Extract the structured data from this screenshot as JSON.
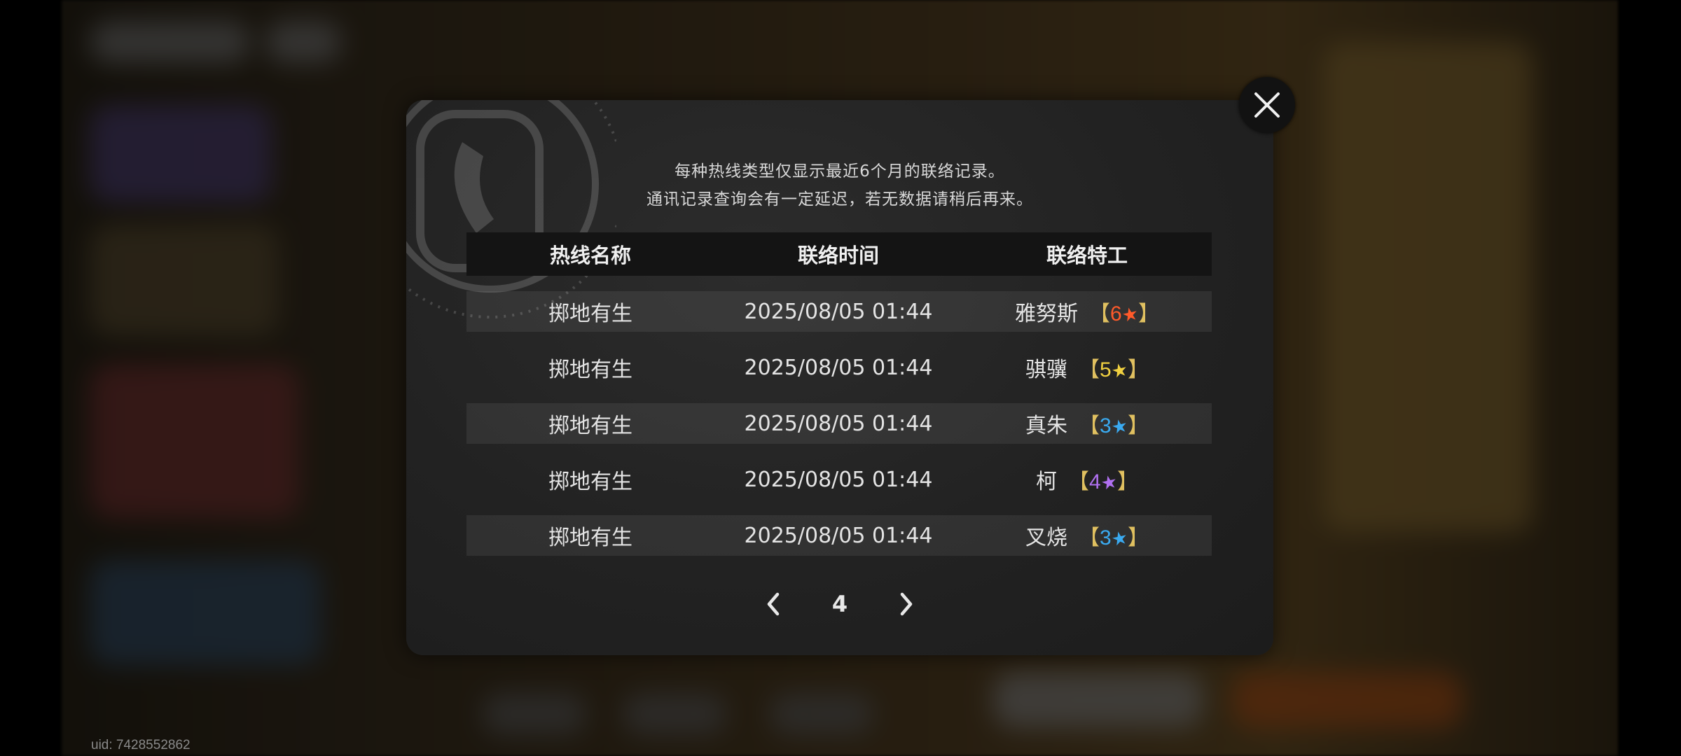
{
  "uid": "uid: 7428552862",
  "notice": {
    "line1": "每种热线类型仅显示最近6个月的联络记录。",
    "line2": "通讯记录查询会有一定延迟，若无数据请稍后再来。"
  },
  "table": {
    "headers": [
      "热线名称",
      "联络时间",
      "联络特工"
    ],
    "rows": [
      {
        "hotline": "掷地有生",
        "time": "2025/08/05 01:44",
        "agent": "雅努斯",
        "stars": "6",
        "color": "#ff5a2a"
      },
      {
        "hotline": "掷地有生",
        "time": "2025/08/05 01:44",
        "agent": "骐骥",
        "stars": "5",
        "color": "#f0d040"
      },
      {
        "hotline": "掷地有生",
        "time": "2025/08/05 01:44",
        "agent": "真朱",
        "stars": "3",
        "color": "#3aaaf0"
      },
      {
        "hotline": "掷地有生",
        "time": "2025/08/05 01:44",
        "agent": "柯",
        "stars": "4",
        "color": "#b070f0"
      },
      {
        "hotline": "掷地有生",
        "time": "2025/08/05 01:44",
        "agent": "叉烧",
        "stars": "3",
        "color": "#3aaaf0"
      }
    ]
  },
  "pager": {
    "page": "4"
  },
  "icons": {
    "close": "close-icon",
    "prev": "chevron-left-icon",
    "next": "chevron-right-icon",
    "star": "star-icon",
    "phone": "phone-icon"
  },
  "bracket_open": "【",
  "bracket_close": "】",
  "accent_bracket": "#e0c060"
}
